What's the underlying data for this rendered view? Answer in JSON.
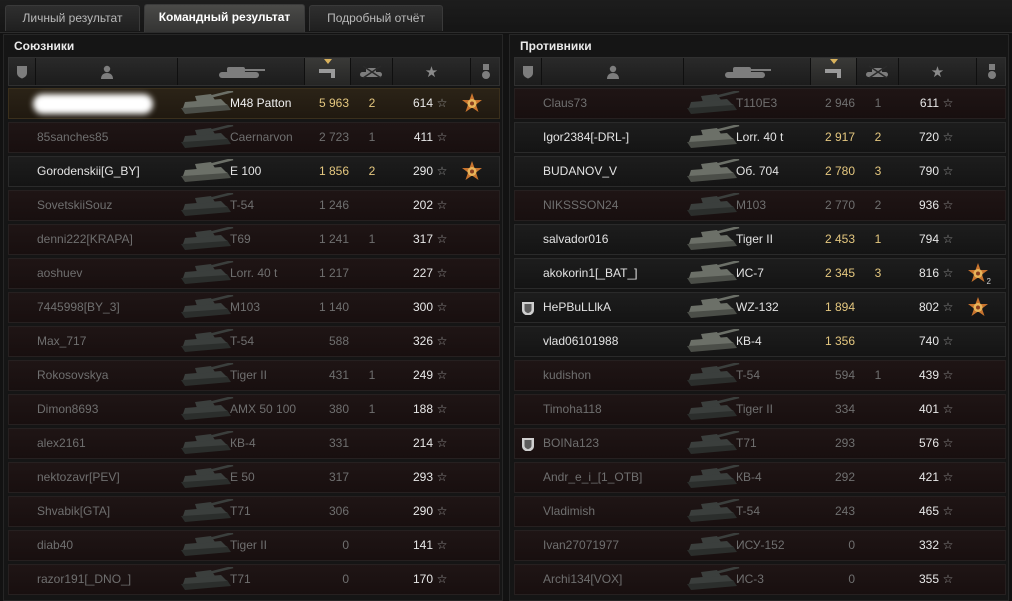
{
  "tabs": [
    {
      "label": "Личный результат",
      "active": false
    },
    {
      "label": "Командный результат",
      "active": true
    },
    {
      "label": "Подробный отчёт",
      "active": false
    }
  ],
  "allies": {
    "title": "Союзники",
    "rows": [
      {
        "name": "",
        "tank": "M48 Patton",
        "damage": "5 963",
        "kills": "2",
        "xp": "614",
        "medal": "medal-icon",
        "alive": true,
        "me": true,
        "clan": false,
        "medal_count": ""
      },
      {
        "name": "85sanches85",
        "tank": "Caernarvon",
        "damage": "2 723",
        "kills": "1",
        "xp": "411",
        "medal": "",
        "alive": false,
        "me": false,
        "clan": false,
        "medal_count": ""
      },
      {
        "name": "Gorodenskii[G_BY]",
        "tank": "E 100",
        "damage": "1 856",
        "kills": "2",
        "xp": "290",
        "medal": "medal-icon",
        "alive": true,
        "me": false,
        "clan": false,
        "medal_count": ""
      },
      {
        "name": "SovetskiiSouz",
        "tank": "T-54",
        "damage": "1 246",
        "kills": "",
        "xp": "202",
        "medal": "",
        "alive": false,
        "me": false,
        "clan": false,
        "medal_count": ""
      },
      {
        "name": "denni222[KRAPA]",
        "tank": "T69",
        "damage": "1 241",
        "kills": "1",
        "xp": "317",
        "medal": "",
        "alive": false,
        "me": false,
        "clan": false,
        "medal_count": ""
      },
      {
        "name": "aoshuev",
        "tank": "Lorr. 40 t",
        "damage": "1 217",
        "kills": "",
        "xp": "227",
        "medal": "",
        "alive": false,
        "me": false,
        "clan": false,
        "medal_count": ""
      },
      {
        "name": "7445998[BY_3]",
        "tank": "M103",
        "damage": "1 140",
        "kills": "",
        "xp": "300",
        "medal": "",
        "alive": false,
        "me": false,
        "clan": false,
        "medal_count": ""
      },
      {
        "name": "Max_717",
        "tank": "T-54",
        "damage": "588",
        "kills": "",
        "xp": "326",
        "medal": "",
        "alive": false,
        "me": false,
        "clan": false,
        "medal_count": ""
      },
      {
        "name": "Rokosovskya",
        "tank": "Tiger II",
        "damage": "431",
        "kills": "1",
        "xp": "249",
        "medal": "",
        "alive": false,
        "me": false,
        "clan": false,
        "medal_count": ""
      },
      {
        "name": "Dimon8693",
        "tank": "AMX 50 100",
        "damage": "380",
        "kills": "1",
        "xp": "188",
        "medal": "",
        "alive": false,
        "me": false,
        "clan": false,
        "medal_count": ""
      },
      {
        "name": "alex2161",
        "tank": "КВ-4",
        "damage": "331",
        "kills": "",
        "xp": "214",
        "medal": "",
        "alive": false,
        "me": false,
        "clan": false,
        "medal_count": ""
      },
      {
        "name": "nektozavr[PEV]",
        "tank": "E 50",
        "damage": "317",
        "kills": "",
        "xp": "293",
        "medal": "",
        "alive": false,
        "me": false,
        "clan": false,
        "medal_count": ""
      },
      {
        "name": "Shvabik[GTA]",
        "tank": "T71",
        "damage": "306",
        "kills": "",
        "xp": "290",
        "medal": "",
        "alive": false,
        "me": false,
        "clan": false,
        "medal_count": ""
      },
      {
        "name": "diab40",
        "tank": "Tiger II",
        "damage": "0",
        "kills": "",
        "xp": "141",
        "medal": "",
        "alive": false,
        "me": false,
        "clan": false,
        "medal_count": ""
      },
      {
        "name": "razor191[_DNO_]",
        "tank": "T71",
        "damage": "0",
        "kills": "",
        "xp": "170",
        "medal": "",
        "alive": false,
        "me": false,
        "clan": false,
        "medal_count": ""
      }
    ]
  },
  "enemies": {
    "title": "Противники",
    "rows": [
      {
        "name": "Claus73",
        "tank": "T110E3",
        "damage": "2 946",
        "kills": "1",
        "xp": "611",
        "medal": "",
        "alive": false,
        "me": false,
        "clan": false,
        "medal_count": ""
      },
      {
        "name": "Igor2384[-DRL-]",
        "tank": "Lorr. 40 t",
        "damage": "2 917",
        "kills": "2",
        "xp": "720",
        "medal": "",
        "alive": true,
        "me": false,
        "clan": false,
        "medal_count": ""
      },
      {
        "name": "BUDANOV_V",
        "tank": "Об. 704",
        "damage": "2 780",
        "kills": "3",
        "xp": "790",
        "medal": "",
        "alive": true,
        "me": false,
        "clan": false,
        "medal_count": ""
      },
      {
        "name": "NIKSSSON24",
        "tank": "M103",
        "damage": "2 770",
        "kills": "2",
        "xp": "936",
        "medal": "",
        "alive": false,
        "me": false,
        "clan": false,
        "medal_count": ""
      },
      {
        "name": "salvador016",
        "tank": "Tiger II",
        "damage": "2 453",
        "kills": "1",
        "xp": "794",
        "medal": "",
        "alive": true,
        "me": false,
        "clan": false,
        "medal_count": ""
      },
      {
        "name": "akokorin1[_BAT_]",
        "tank": "ИС-7",
        "damage": "2 345",
        "kills": "3",
        "xp": "816",
        "medal": "medal-icon",
        "alive": true,
        "me": false,
        "clan": false,
        "medal_count": "2"
      },
      {
        "name": "HePBuLLlkA",
        "tank": "WZ-132",
        "damage": "1 894",
        "kills": "",
        "xp": "802",
        "medal": "medal-icon",
        "alive": true,
        "me": false,
        "clan": true,
        "medal_count": ""
      },
      {
        "name": "vlad06101988",
        "tank": "КВ-4",
        "damage": "1 356",
        "kills": "",
        "xp": "740",
        "medal": "",
        "alive": true,
        "me": false,
        "clan": false,
        "medal_count": ""
      },
      {
        "name": "kudishon",
        "tank": "T-54",
        "damage": "594",
        "kills": "1",
        "xp": "439",
        "medal": "",
        "alive": false,
        "me": false,
        "clan": false,
        "medal_count": ""
      },
      {
        "name": "Timoha118",
        "tank": "Tiger II",
        "damage": "334",
        "kills": "",
        "xp": "401",
        "medal": "",
        "alive": false,
        "me": false,
        "clan": false,
        "medal_count": ""
      },
      {
        "name": "BOINa123",
        "tank": "T71",
        "damage": "293",
        "kills": "",
        "xp": "576",
        "medal": "",
        "alive": false,
        "me": false,
        "clan": true,
        "medal_count": ""
      },
      {
        "name": "Andr_e_i_[1_OTB]",
        "tank": "КВ-4",
        "damage": "292",
        "kills": "",
        "xp": "421",
        "medal": "",
        "alive": false,
        "me": false,
        "clan": false,
        "medal_count": ""
      },
      {
        "name": "Vladimish",
        "tank": "T-54",
        "damage": "243",
        "kills": "",
        "xp": "465",
        "medal": "",
        "alive": false,
        "me": false,
        "clan": false,
        "medal_count": ""
      },
      {
        "name": "Ivan27071977",
        "tank": "ИСУ-152",
        "damage": "0",
        "kills": "",
        "xp": "332",
        "medal": "",
        "alive": false,
        "me": false,
        "clan": false,
        "medal_count": ""
      },
      {
        "name": "Archi134[VOX]",
        "tank": "ИС-3",
        "damage": "0",
        "kills": "",
        "xp": "355",
        "medal": "",
        "alive": false,
        "me": false,
        "clan": false,
        "medal_count": ""
      }
    ]
  },
  "colors": {
    "accent": "#e4c77f",
    "dead_row": "#1f1515",
    "alive_row": "#1d1d1d",
    "my_row": "#2b2317"
  }
}
